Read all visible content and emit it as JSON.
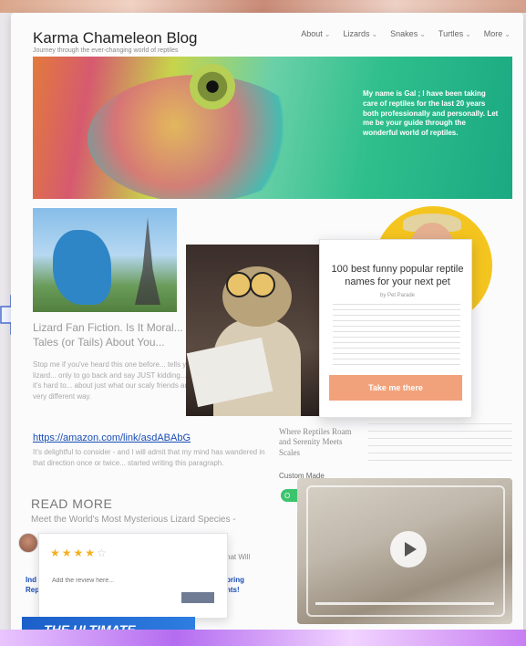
{
  "site": {
    "title": "Karma Chameleon Blog",
    "tagline": "Journey through the ever-changing world of reptiles"
  },
  "nav": [
    {
      "label": "About"
    },
    {
      "label": "Lizards"
    },
    {
      "label": "Snakes"
    },
    {
      "label": "Turtles"
    },
    {
      "label": "More"
    }
  ],
  "hero": {
    "text": "My name is Gal ; I have been taking care of reptiles for the last 20 years both professionally and personally. Let me be your guide through the wonderful world of reptiles."
  },
  "post": {
    "title": "Lizard Fan Fiction. Is It Moral... Up Tales (or Tails) About You...",
    "excerpt": "Stop me if you've heard this one before... tells you about the controversial lizard... only to go back and say JUST kidding... up in my head. Of course, it's hard to... about just what our scaly friends are up... see the world in a very different way.",
    "link": "https://amazon.com/link/asdABAbG",
    "excerpt2": "It's delightful to consider - and I will admit that my mind has wandered in that direction once or twice... started writing this paragraph.",
    "read_more": "READ MORE",
    "meet": "Meet the World's Most Mysterious Lizard Species -"
  },
  "popup": {
    "title": "100 best funny popular reptile names for your next pet",
    "byline": "by Pet Parade",
    "button": "Take me there"
  },
  "sidebar_card": {
    "heading": "Where Reptiles Roam and Serenity Meets Scales",
    "custom_made": "Custom Made",
    "badge": "O"
  },
  "rating": {
    "stars_filled": 4,
    "stars_total": 5,
    "placeholder": "Add the review here..."
  },
  "snippets": {
    "left_1": "Ind",
    "left_2": "Rep",
    "mid_1": "hat Will",
    "mid_2a": "bring",
    "mid_2b": "nts!"
  },
  "banner": {
    "text": "THE ULTIMATE"
  },
  "colors": {
    "link": "#1a4db4",
    "popup_button": "#f2a27a",
    "badge_green": "#3cc46d",
    "star": "#f5b01f"
  }
}
